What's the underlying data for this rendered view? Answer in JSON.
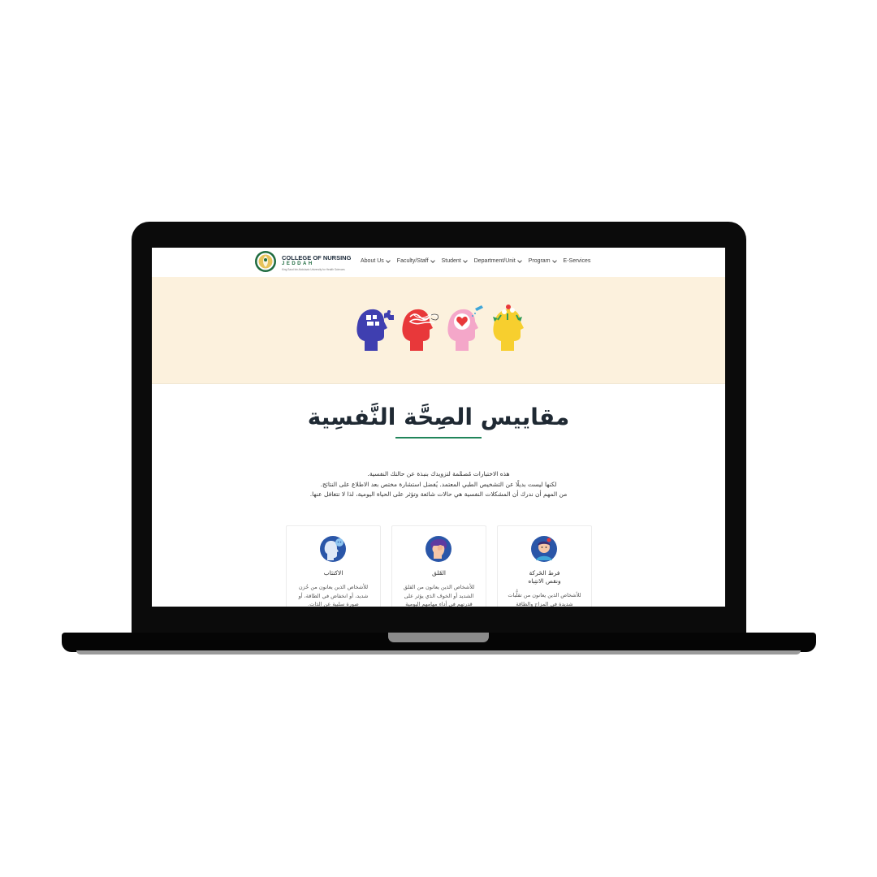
{
  "header": {
    "brand_title": "COLLEGE OF NURSING",
    "brand_city": "JEDDAH",
    "brand_sub": "King Saud bin Abdulaziz University for Health Sciences",
    "menu": [
      {
        "label": "About Us"
      },
      {
        "label": "Faculty/Staff"
      },
      {
        "label": "Student"
      },
      {
        "label": "Department/Unit"
      },
      {
        "label": "Program"
      },
      {
        "label": "E-Services"
      }
    ]
  },
  "colors": {
    "accent": "#21855a",
    "hero_bg": "#fcf1dd",
    "head_blue": "#3f3fb0",
    "head_red": "#e8383a",
    "head_pink": "#f4a7c9",
    "head_yellow": "#f7cf2e"
  },
  "main": {
    "title": "مقاييس الصِحَّة النَّفسِية",
    "intro": [
      "هذه الاختبارات مُصمَّمة لتزويدك بنبذة عن حالتك النفسية.",
      "لكنها ليست بديلًا عن التشخيص الطبي المعتمد. يُفضل استشارة مختص بعد الاطلاع على النتائج.",
      "من المهم أن ندرك أن المشكلات النفسية هي حالات شائعة وتؤثر على الحياة اليومية، لذا لا تتغافل عنها."
    ],
    "cards": [
      {
        "icon": "depression-head-icon",
        "title": "الاكتئاب",
        "desc": "للأشخاص الذين يعانون من حُزن شديد، أو انخفاض في الطاقة، أو صورة سلبية عن الذات."
      },
      {
        "icon": "anxiety-head-icon",
        "title": "القَلق",
        "desc": "للأشخاص الذين يعانون من القلق الشديد أو الخوف الذي يؤثر على قدرتهم في أداء مهامهم اليومية"
      },
      {
        "icon": "adhd-head-icon",
        "title": "فرط الحَركة\nونقص الانتِباه",
        "desc": "للأشخاص الذين يعانون من تقلُّبات شديدة في المزاج والطاقة"
      }
    ]
  }
}
